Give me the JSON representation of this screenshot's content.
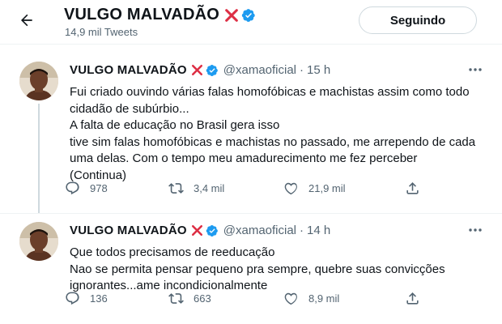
{
  "header": {
    "title": "VULGO MALVADÃO",
    "tweets_count": "14,9 mil Tweets",
    "follow_label": "Seguindo"
  },
  "tweets": [
    {
      "name": "VULGO MALVADÃO",
      "handle": "@xamaoficial",
      "dot": "·",
      "time": "15 h",
      "lines": [
        "Fui criado ouvindo várias falas homofóbicas e machistas assim como todo",
        "cidadão de subúrbio...",
        "A falta de educação no Brasil gera isso",
        "tive sim falas homofóbicas e machistas no passado, me arrependo de cada",
        "uma delas. Com o tempo meu amadurecimento me fez perceber",
        "(Continua)"
      ],
      "replies": "978",
      "retweets": "3,4 mil",
      "likes": "21,9 mil"
    },
    {
      "name": "VULGO MALVADÃO",
      "handle": "@xamaoficial",
      "dot": "·",
      "time": "14 h",
      "lines": [
        "Que todos precisamos de reeducação",
        "Nao se permita pensar pequeno pra sempre, quebre suas convicções",
        "ignorantes...ame incondicionalmente"
      ],
      "replies": "136",
      "retweets": "663",
      "likes": "8,9 mil"
    }
  ],
  "icons": {
    "back": "arrow-left-icon",
    "cross": "cross-mark-icon",
    "verified": "verified-badge-icon",
    "more": "more-horizontal-icon",
    "reply": "reply-icon",
    "retweet": "retweet-icon",
    "like": "heart-icon",
    "share": "share-icon"
  },
  "colors": {
    "cross_red": "#e0245e",
    "verified_blue": "#1d9bf0",
    "secondary_text": "#536471",
    "primary_text": "#0f1419"
  }
}
